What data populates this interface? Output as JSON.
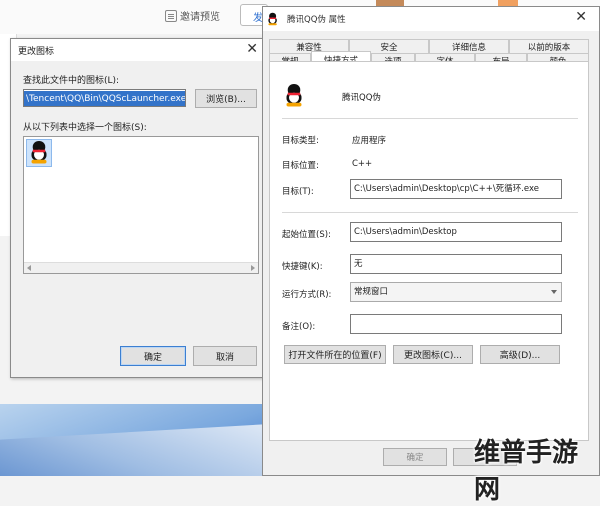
{
  "background": {
    "invite_label": "邀请预览",
    "pill_char": "发"
  },
  "change_icon_dialog": {
    "title": "更改图标",
    "find_label": "查找此文件中的图标(L):",
    "path_value": "\\Tencent\\QQ\\Bin\\QQScLauncher.exe",
    "browse_label": "浏览(B)...",
    "select_label": "从以下列表中选择一个图标(S):",
    "ok_label": "确定",
    "cancel_label": "取消"
  },
  "props_dialog": {
    "title": "腾讯QQ伪 属性",
    "tabs_row1": [
      "兼容性",
      "安全",
      "详细信息",
      "以前的版本"
    ],
    "tabs_row2": [
      "常规",
      "快捷方式",
      "选项",
      "字体",
      "布局",
      "颜色"
    ],
    "active_tab": "快捷方式",
    "app_name": "腾讯QQ伪",
    "target_type_label": "目标类型:",
    "target_type_value": "应用程序",
    "target_location_label": "目标位置:",
    "target_location_value": "C++",
    "target_label": "目标(T):",
    "target_value": "C:\\Users\\admin\\Desktop\\cp\\C++\\死循环.exe",
    "start_in_label": "起始位置(S):",
    "start_in_value": "C:\\Users\\admin\\Desktop",
    "shortcut_key_label": "快捷键(K):",
    "shortcut_key_value": "无",
    "run_label": "运行方式(R):",
    "run_value": "常规窗口",
    "comment_label": "备注(O):",
    "comment_value": "",
    "open_location_label": "打开文件所在的位置(F)",
    "change_icon_label": "更改图标(C)...",
    "advanced_label": "高级(D)...",
    "footer_ok_label": "确定"
  },
  "watermark": "维普手游网"
}
